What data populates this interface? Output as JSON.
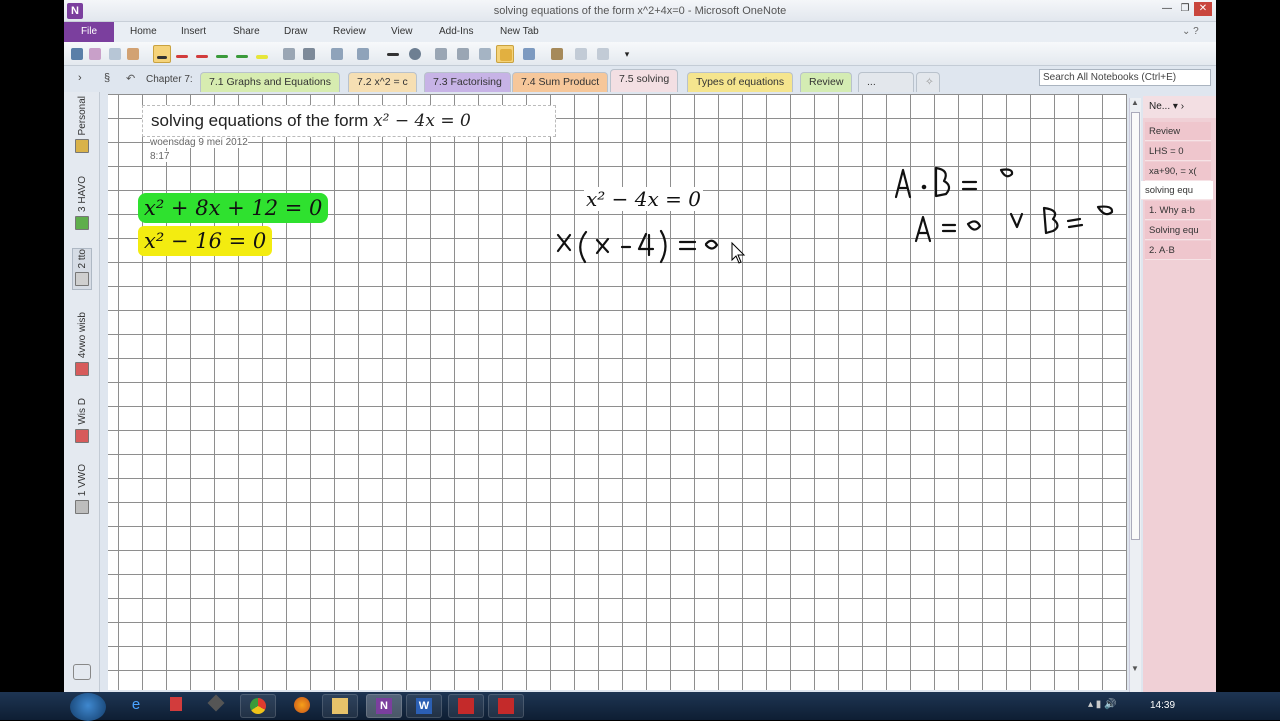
{
  "window": {
    "title": "solving equations of the form x^2+4x=0  -  Microsoft OneNote",
    "logo": "N",
    "controls": [
      "—",
      "❐",
      "✕"
    ]
  },
  "menu": {
    "file": "File",
    "items": [
      "Home",
      "Insert",
      "Share",
      "Draw",
      "Review",
      "View",
      "Add-Ins",
      "New Tab"
    ]
  },
  "toolbar_icons": [
    "undo-icon",
    "eraser-icon",
    "lasso-icon",
    "pan-icon",
    "pen-black-icon",
    "pen-red-icon",
    "pen-red2-icon",
    "pen-green-icon",
    "pen-green2-icon",
    "highlighter-yellow-icon",
    "type-icon",
    "insert-space-icon",
    "shapes-icon",
    "lines-icon",
    "color-icon",
    "rotate-icon",
    "ink-to-text-icon",
    "ink-to-math-icon",
    "selection-icon",
    "arrange-icon",
    "draw-icon",
    "format-icon",
    "more-icon"
  ],
  "sections": {
    "breadcrumb": "Chapter 7:",
    "tabs": [
      {
        "label": "7.1 Graphs and Equations",
        "color": "#d7ecb0"
      },
      {
        "label": "7.2 x^2 = c",
        "color": "#f6dfb3"
      },
      {
        "label": "7.3 Factorising",
        "color": "#c7b3e6"
      },
      {
        "label": "7.4 Sum Product",
        "color": "#f6c79a"
      },
      {
        "label": "7.5 solving",
        "color": "#f3dfe3"
      },
      {
        "label": "Types of equations",
        "color": "#f5e58e"
      },
      {
        "label": "Review",
        "color": "#d4ecb3"
      },
      {
        "label": "...",
        "color": "#e3e7ec"
      }
    ],
    "search_placeholder": "Search All Notebooks (Ctrl+E)"
  },
  "notebooks": [
    {
      "label": "Personal",
      "color": "#d9b24a"
    },
    {
      "label": "3 HAVO",
      "color": "#5fae4c"
    },
    {
      "label": "2 tto",
      "color": "#cfcfcf"
    },
    {
      "label": "4vwo wisb",
      "color": "#d75b5b"
    },
    {
      "label": "Wis D",
      "color": "#d75b5b"
    },
    {
      "label": "1 VWO",
      "color": "#bdbdbd"
    }
  ],
  "page": {
    "title_prefix": "solving equations of the form ",
    "title_math": "x² − 4x = 0",
    "date": "woensdag 9 mei 2012",
    "time": "8:17",
    "highlight_1": "x² + 8x + 12 = 0",
    "highlight_2": "x² − 16 = 0",
    "center_eq": "x² − 4x = 0",
    "ink_1": "x(x - 4) = 0",
    "ink_2": "A · B = 0",
    "ink_3": "A = 0  v  B = 0"
  },
  "page_list": {
    "header": "Ne...",
    "pages": [
      "Review",
      "LHS = 0",
      "xa+90, = x(",
      "solving equ",
      "1. Why a·b",
      "Solving equ",
      "2. A·B"
    ],
    "selected_index": 3
  },
  "taskbar": {
    "clock": "14:39",
    "apps": [
      "ie-icon",
      "office-icon",
      "tools-icon",
      "chrome-icon",
      "firefox-icon",
      "explorer-icon",
      "onenote-icon",
      "word-icon",
      "math-red-icon",
      "math-red2-icon"
    ]
  }
}
